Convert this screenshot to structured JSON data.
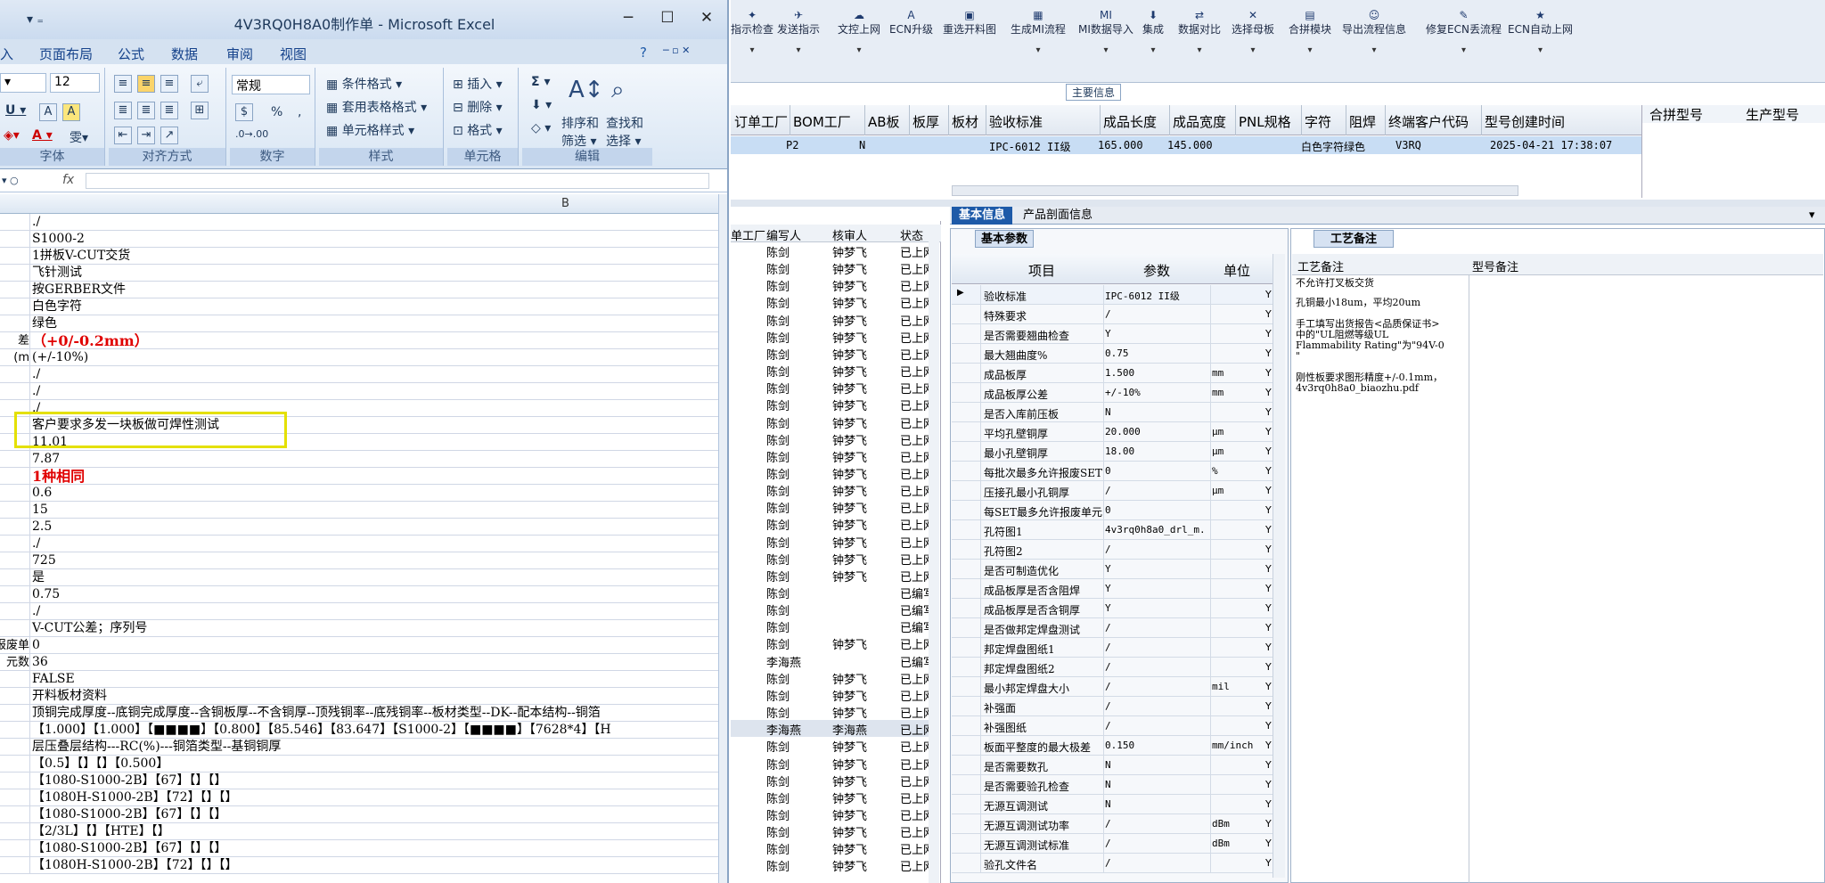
{
  "excel": {
    "title": "4V3RQ0H8A0制作单 - Microsoft Excel",
    "tabs": [
      "入",
      "页面布局",
      "公式",
      "数据",
      "审阅",
      "视图"
    ],
    "font_size": "12",
    "number_format": "常规",
    "groups": [
      "字体",
      "对齐方式",
      "数字",
      "样式",
      "单元格",
      "编辑"
    ],
    "styles": [
      "条件格式",
      "套用表格格式",
      "单元格样式"
    ],
    "cells_cmds": [
      "插入",
      "删除",
      "格式"
    ],
    "edit_cmds": [
      "排序和筛选",
      "查找和选择"
    ],
    "col_b": "B",
    "rows": [
      {
        "a": "",
        "b": "./"
      },
      {
        "a": "",
        "b": "S1000-2"
      },
      {
        "a": "",
        "b": "1拼板V-CUT交货"
      },
      {
        "a": "",
        "b": "飞针测试"
      },
      {
        "a": "",
        "b": "按GERBER文件"
      },
      {
        "a": "",
        "b": "白色字符"
      },
      {
        "a": "",
        "b": "绿色"
      },
      {
        "a": "差",
        "b": "（+0/-0.2mm）",
        "red": true
      },
      {
        "a": "m)",
        "b": "(+/-10%)"
      },
      {
        "a": "",
        "b": "./"
      },
      {
        "a": "",
        "b": "./"
      },
      {
        "a": "",
        "b": "./"
      },
      {
        "a": "",
        "b": "客户要求多发一块板做可焊性测试"
      },
      {
        "a": "",
        "b": "11.01"
      },
      {
        "a": "",
        "b": "7.87"
      },
      {
        "a": "",
        "b": "1种相同",
        "red": true
      },
      {
        "a": "",
        "b": "0.6"
      },
      {
        "a": "",
        "b": "15"
      },
      {
        "a": "",
        "b": "2.5"
      },
      {
        "a": "",
        "b": "./"
      },
      {
        "a": "",
        "b": "725"
      },
      {
        "a": "",
        "b": "是"
      },
      {
        "a": "",
        "b": "0.75"
      },
      {
        "a": "",
        "b": "./"
      },
      {
        "a": "",
        "b": "V-CUT公差；序列号"
      },
      {
        "a": "报废单",
        "b": "0"
      },
      {
        "a": "元数",
        "b": "36"
      },
      {
        "a": "",
        "b": "FALSE"
      },
      {
        "a": "",
        "b": "开料板材资料"
      },
      {
        "a": "",
        "b": "顶铜完成厚度--底铜完成厚度--含铜板厚--不含铜厚--顶残铜率--底残铜率--板材类型--DK--配本结构--铜箔"
      },
      {
        "a": "",
        "b": "【1.000】【1.000】【■■■■】【0.800】【85.546】【83.647】【S1000-2】【■■■■】【7628*4】【H"
      },
      {
        "a": "",
        "b": "层压叠层结构---RC(%)---铜箔类型--基铜铜厚"
      },
      {
        "a": "",
        "b": "【0.5】【】【】【0.500】"
      },
      {
        "a": "",
        "b": "【1080-S1000-2B】【67】【】【】"
      },
      {
        "a": "",
        "b": "【1080H-S1000-2B】【72】【】【】"
      },
      {
        "a": "",
        "b": "【1080-S1000-2B】【67】【】【】"
      },
      {
        "a": "",
        "b": "【2/3L】【】【HTE】【】"
      },
      {
        "a": "",
        "b": "【1080-S1000-2B】【67】【】【】"
      },
      {
        "a": "",
        "b": "【1080H-S1000-2B】【72】【】【】"
      }
    ]
  },
  "toolbar": [
    {
      "icon": "✦",
      "label": "指示检查"
    },
    {
      "icon": "✈",
      "label": "发送指示"
    },
    {
      "icon": "☁",
      "label": "文控上网"
    },
    {
      "icon": "A",
      "label": "ECN升级"
    },
    {
      "icon": "▣",
      "label": "重选开料图"
    },
    {
      "icon": "▦",
      "label": "生成MI流程"
    },
    {
      "icon": "MI",
      "label": "MI数据导入"
    },
    {
      "icon": "⬇",
      "label": "集成"
    },
    {
      "icon": "⇄",
      "label": "数据对比"
    },
    {
      "icon": "✕",
      "label": "选择母板"
    },
    {
      "icon": "▤",
      "label": "合拼模块"
    },
    {
      "icon": "☺",
      "label": "导出流程信息"
    },
    {
      "icon": "✎",
      "label": "修复ECN丢流程"
    },
    {
      "icon": "★",
      "label": "ECN自动上网"
    }
  ],
  "main_info_label": "主要信息",
  "main_headers": [
    "订单工厂",
    "BOM工厂",
    "AB板",
    "板厚",
    "板材",
    "验收标准",
    "成品长度",
    "成品宽度",
    "PNL规格",
    "字符",
    "阻焊",
    "终端客户代码",
    "型号创建时间"
  ],
  "main_values": [
    "P2",
    "N",
    "IPC-6012 II级",
    "165.000",
    "145.000",
    "白色字符",
    "绿色",
    "V3RQ",
    "2025-04-21 17:38:07"
  ],
  "right_headers": [
    "合拼型号",
    "生产型号"
  ],
  "list_headers": [
    "单工厂",
    "编写人",
    "核审人",
    "状态"
  ],
  "list_rows": [
    [
      "陈剑",
      "钟梦飞",
      "已上网"
    ],
    [
      "陈剑",
      "钟梦飞",
      "已上网"
    ],
    [
      "陈剑",
      "钟梦飞",
      "已上网"
    ],
    [
      "陈剑",
      "钟梦飞",
      "已上网"
    ],
    [
      "陈剑",
      "钟梦飞",
      "已上网"
    ],
    [
      "陈剑",
      "钟梦飞",
      "已上网"
    ],
    [
      "陈剑",
      "钟梦飞",
      "已上网"
    ],
    [
      "陈剑",
      "钟梦飞",
      "已上网"
    ],
    [
      "陈剑",
      "钟梦飞",
      "已上网"
    ],
    [
      "陈剑",
      "钟梦飞",
      "已上网"
    ],
    [
      "陈剑",
      "钟梦飞",
      "已上网"
    ],
    [
      "陈剑",
      "钟梦飞",
      "已上网"
    ],
    [
      "陈剑",
      "钟梦飞",
      "已上网"
    ],
    [
      "陈剑",
      "钟梦飞",
      "已上网"
    ],
    [
      "陈剑",
      "钟梦飞",
      "已上网"
    ],
    [
      "陈剑",
      "钟梦飞",
      "已上网"
    ],
    [
      "陈剑",
      "钟梦飞",
      "已上网"
    ],
    [
      "陈剑",
      "钟梦飞",
      "已上网"
    ],
    [
      "陈剑",
      "钟梦飞",
      "已上网"
    ],
    [
      "陈剑",
      "钟梦飞",
      "已上网"
    ],
    [
      "陈剑",
      "",
      "已编写"
    ],
    [
      "陈剑",
      "",
      "已编写"
    ],
    [
      "陈剑",
      "",
      "已编写"
    ],
    [
      "陈剑",
      "钟梦飞",
      "已上网"
    ],
    [
      "李海燕",
      "",
      "已编写"
    ],
    [
      "陈剑",
      "钟梦飞",
      "已上网"
    ],
    [
      "陈剑",
      "钟梦飞",
      "已上网"
    ],
    [
      "陈剑",
      "钟梦飞",
      "已上网"
    ],
    [
      "李海燕",
      "李海燕",
      "已上网"
    ],
    [
      "陈剑",
      "钟梦飞",
      "已上网"
    ],
    [
      "陈剑",
      "钟梦飞",
      "已上网"
    ],
    [
      "陈剑",
      "钟梦飞",
      "已上网"
    ],
    [
      "陈剑",
      "钟梦飞",
      "已上网"
    ],
    [
      "陈剑",
      "钟梦飞",
      "已上网"
    ],
    [
      "陈剑",
      "钟梦飞",
      "已上网"
    ],
    [
      "陈剑",
      "钟梦飞",
      "已上网"
    ],
    [
      "陈剑",
      "钟梦飞",
      "已上网"
    ]
  ],
  "tabs": {
    "basic": "基本信息",
    "section": "产品剖面信息"
  },
  "basic": {
    "caption": "基本参数",
    "headers": [
      "项目",
      "参数",
      "单位"
    ],
    "rows": [
      [
        "验收标准",
        "IPC-6012 II级",
        "",
        "Y"
      ],
      [
        "特殊要求",
        "/",
        "",
        "Y"
      ],
      [
        "是否需要翘曲检查",
        "Y",
        "",
        "Y"
      ],
      [
        "最大翘曲度%",
        "0.75",
        "",
        "Y"
      ],
      [
        "成品板厚",
        "1.500",
        "mm",
        "Y"
      ],
      [
        "成品板厚公差",
        "+/-10%",
        "mm",
        "Y"
      ],
      [
        "是否入库前压板",
        "N",
        "",
        "Y"
      ],
      [
        "平均孔壁铜厚",
        "20.000",
        "μm",
        "Y"
      ],
      [
        "最小孔壁铜厚",
        "18.00",
        "μm",
        "Y"
      ],
      [
        "每批次最多允许报废SET",
        "0",
        "%",
        "Y"
      ],
      [
        "压接孔最小孔铜厚",
        "/",
        "μm",
        "Y"
      ],
      [
        "每SET最多允许报废单元",
        "0",
        "",
        "Y"
      ],
      [
        "孔符图1",
        "4v3rq0h8a0_drl_m...",
        "",
        "Y"
      ],
      [
        "孔符图2",
        "/",
        "",
        "Y"
      ],
      [
        "是否可制造优化",
        "Y",
        "",
        "Y"
      ],
      [
        "成品板厚是否含阻焊",
        "Y",
        "",
        "Y"
      ],
      [
        "成品板厚是否含铜厚",
        "Y",
        "",
        "Y"
      ],
      [
        "是否做邦定焊盘测试",
        "/",
        "",
        "Y"
      ],
      [
        "邦定焊盘图纸1",
        "/",
        "",
        "Y"
      ],
      [
        "邦定焊盘图纸2",
        "/",
        "",
        "Y"
      ],
      [
        "最小邦定焊盘大小",
        "/",
        "mil",
        "Y"
      ],
      [
        "补强面",
        "/",
        "",
        "Y"
      ],
      [
        "补强图纸",
        "/",
        "",
        "Y"
      ],
      [
        "板面平整度的最大极差",
        "0.150",
        "mm/inch",
        "Y"
      ],
      [
        "是否需要数孔",
        "N",
        "",
        "Y"
      ],
      [
        "是否需要验孔检查",
        "N",
        "",
        "Y"
      ],
      [
        "无源互调测试",
        "N",
        "",
        "Y"
      ],
      [
        "无源互调测试功率",
        "/",
        "dBm",
        "Y"
      ],
      [
        "无源互调测试标准",
        "/",
        "dBm",
        "Y"
      ],
      [
        "验孔文件名",
        "/",
        "",
        "Y"
      ]
    ]
  },
  "process": {
    "caption": "工艺备注",
    "h1": "工艺备注",
    "h2": "型号备注",
    "notes": [
      "不允许打叉板交货",
      "孔铜最小18um，平均20um",
      "手工填写出货报告<品质保证书>\n中的\"UL阻燃等级UL\nFlammability Rating\"为\"94V-0\n\"",
      "刚性板要求图形精度+/-0.1mm，\n4v3rq0h8a0_biaozhu.pdf"
    ]
  }
}
